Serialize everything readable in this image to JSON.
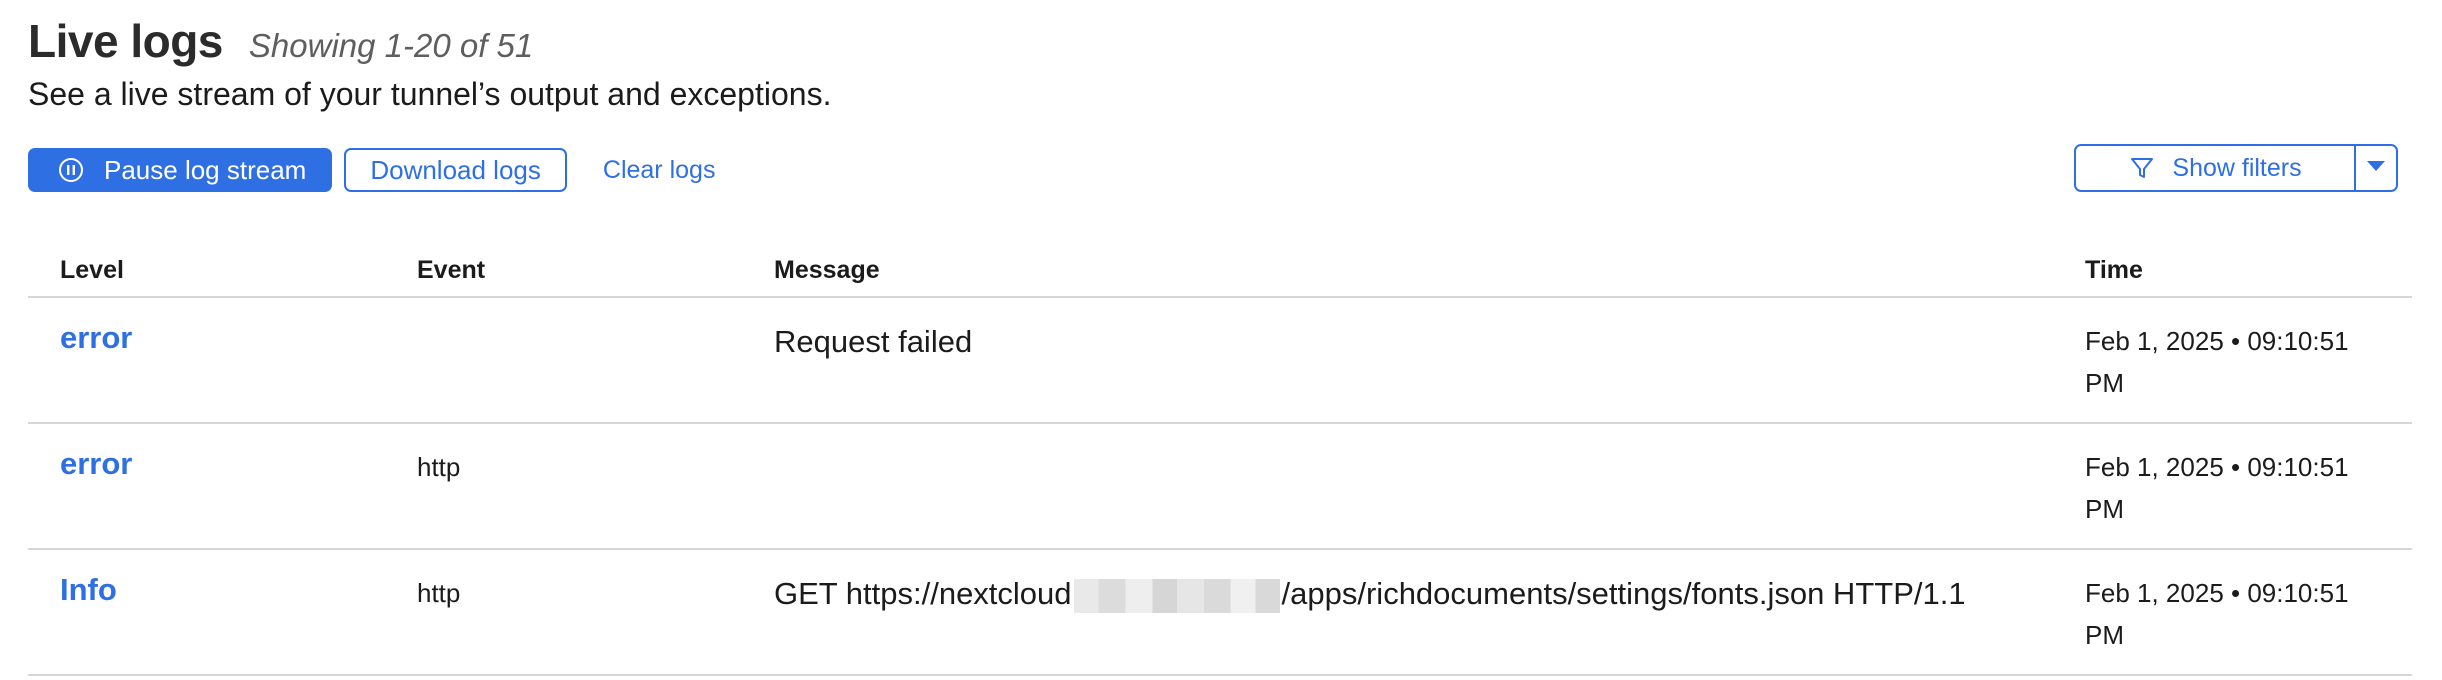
{
  "header": {
    "title": "Live logs",
    "showing": "Showing 1-20 of 51",
    "subtitle": "See a live stream of your tunnel’s output and exceptions."
  },
  "toolbar": {
    "pause_label": "Pause log stream",
    "download_label": "Download logs",
    "clear_label": "Clear logs",
    "filters_label": "Show filters"
  },
  "table": {
    "columns": [
      "Level",
      "Event",
      "Message",
      "Time"
    ],
    "rows": [
      {
        "level": "error",
        "event": "",
        "message": "Request failed",
        "time": "Feb 1, 2025 • 09:10:51 PM"
      },
      {
        "level": "error",
        "event": "http",
        "message": "",
        "time": "Feb 1, 2025 • 09:10:51 PM"
      },
      {
        "level": "Info",
        "event": "http",
        "message_prefix": "GET https://nextcloud",
        "message_suffix": "/apps/richdocuments/settings/fonts.json HTTP/1.1",
        "time": "Feb 1, 2025 • 09:10:51 PM"
      }
    ]
  },
  "colors": {
    "accent": "#2f6fe4",
    "text": "#1b1b1b",
    "divider": "#d6d6d6"
  },
  "icons": {
    "pause": "pause-circle-icon",
    "filter": "funnel-icon",
    "dropdown": "caret-down-icon"
  }
}
